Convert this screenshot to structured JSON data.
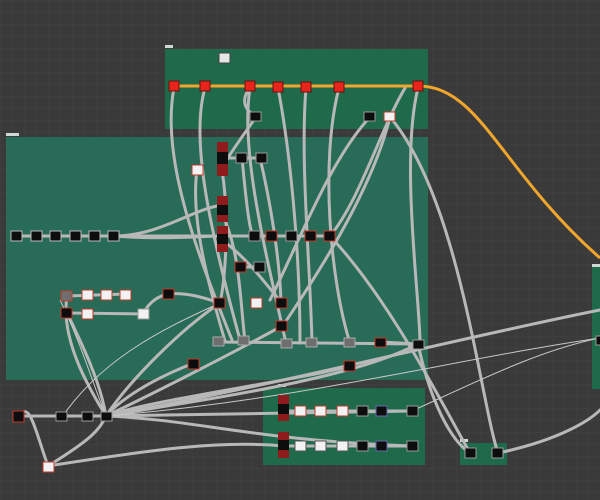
{
  "editor": {
    "canvas_label": "node-graph-canvas"
  },
  "colors": {
    "background": "#3a3a3a",
    "grid": "#444444",
    "group_fill": "#1e6a4a",
    "group_fill_light": "#27705a",
    "wire": "#b9b9b9",
    "active_wire": "#f5a623",
    "node_red": "#e8251a"
  },
  "groups": [
    {
      "id": "top",
      "title": "",
      "color": "#1e6a4a"
    },
    {
      "id": "main",
      "title": "",
      "color": "#27705a"
    },
    {
      "id": "bottom",
      "title": "",
      "color": "#1e6a4a"
    },
    {
      "id": "small",
      "title": "",
      "color": "#1e6a4a"
    },
    {
      "id": "right",
      "title": "",
      "color": "#1e6a4a"
    }
  ]
}
